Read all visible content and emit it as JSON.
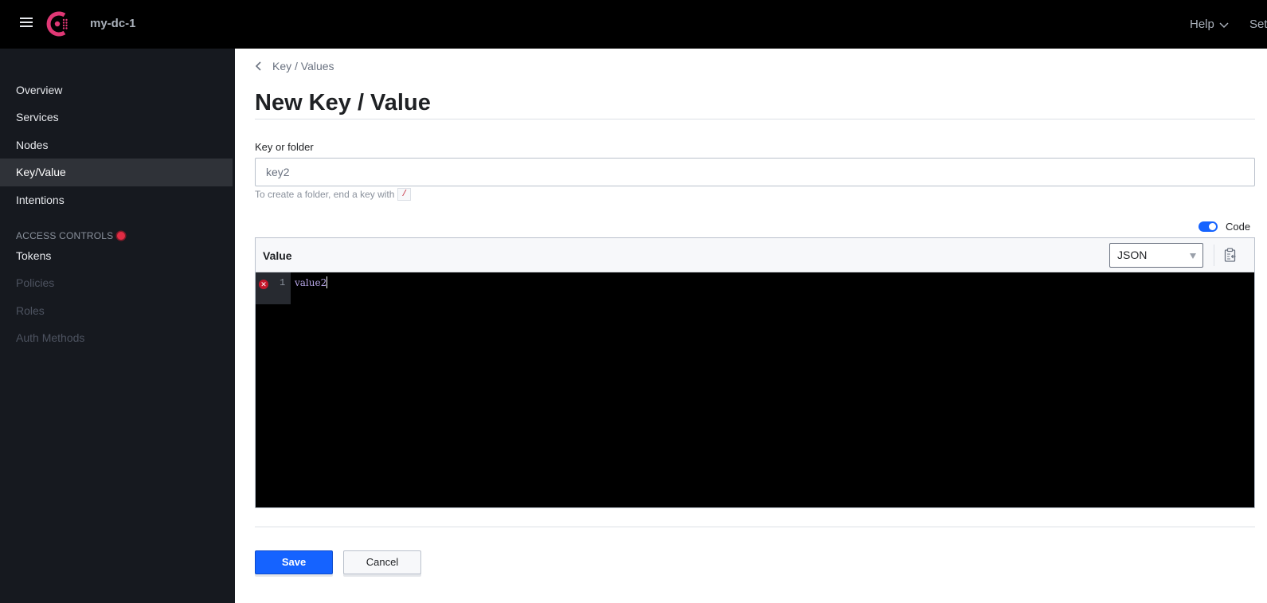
{
  "topbar": {
    "datacenter": "my-dc-1",
    "help_label": "Help",
    "settings_label": "Settings",
    "brand_color": "#e03875"
  },
  "sidebar": {
    "items": [
      {
        "label": "Overview",
        "state": "normal"
      },
      {
        "label": "Services",
        "state": "normal"
      },
      {
        "label": "Nodes",
        "state": "normal"
      },
      {
        "label": "Key/Value",
        "state": "active"
      },
      {
        "label": "Intentions",
        "state": "normal"
      }
    ],
    "access_heading": "ACCESS CONTROLS",
    "access_items": [
      {
        "label": "Tokens",
        "state": "normal"
      },
      {
        "label": "Policies",
        "state": "disabled"
      },
      {
        "label": "Roles",
        "state": "disabled"
      },
      {
        "label": "Auth Methods",
        "state": "disabled"
      }
    ]
  },
  "main": {
    "breadcrumb": "Key / Values",
    "title": "New Key / Value",
    "key_field": {
      "label": "Key or folder",
      "value": "key2",
      "help_text": "To create a folder, end a key with",
      "help_code": "/"
    },
    "code_toggle": {
      "label": "Code",
      "on": true
    },
    "editor": {
      "header_label": "Value",
      "language": "JSON",
      "lines": [
        {
          "number": "1",
          "text": "value2",
          "error": true
        }
      ]
    },
    "buttons": {
      "save": "Save",
      "cancel": "Cancel"
    }
  }
}
